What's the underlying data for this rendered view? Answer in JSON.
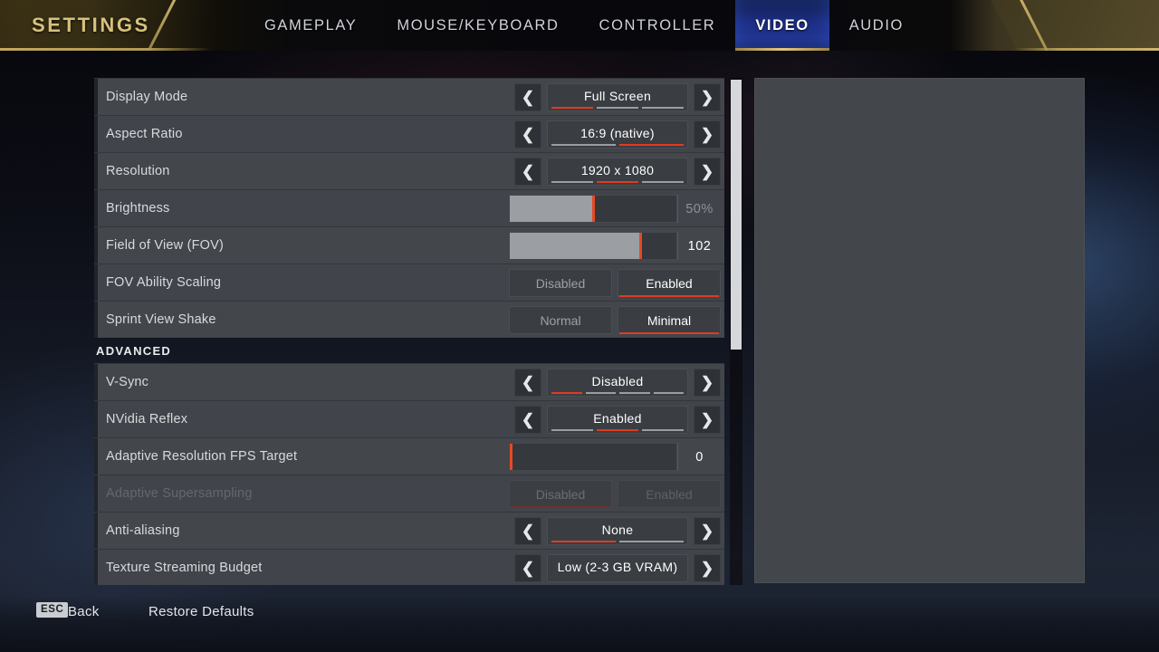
{
  "header": {
    "title": "SETTINGS",
    "tabs": [
      {
        "label": "GAMEPLAY",
        "active": false
      },
      {
        "label": "MOUSE/KEYBOARD",
        "active": false
      },
      {
        "label": "CONTROLLER",
        "active": false
      },
      {
        "label": "VIDEO",
        "active": true
      },
      {
        "label": "AUDIO",
        "active": false
      }
    ]
  },
  "accent_colors": {
    "gold": "#c2a85f",
    "active_tab_blue": "#20348f",
    "selection_red": "#e03b20",
    "row_background": "#43464b",
    "slider_fill": "#9b9ea2"
  },
  "settings": [
    {
      "name": "display-mode",
      "label": "Display Mode",
      "type": "spinner",
      "value": "Full Screen",
      "segments": 3,
      "selected_index": 0
    },
    {
      "name": "aspect-ratio",
      "label": "Aspect Ratio",
      "type": "spinner",
      "value": "16:9 (native)",
      "segments": 2,
      "selected_index": 1
    },
    {
      "name": "resolution",
      "label": "Resolution",
      "type": "spinner",
      "value": "1920 x 1080",
      "segments": 3,
      "selected_index": 1
    },
    {
      "name": "brightness",
      "label": "Brightness",
      "type": "slider",
      "value": "50%",
      "fill_percent": 50,
      "dim_value": true
    },
    {
      "name": "field-of-view",
      "label": "Field of View (FOV)",
      "type": "slider",
      "value": "102",
      "fill_percent": 78,
      "dim_value": false
    },
    {
      "name": "fov-ability-scaling",
      "label": "FOV Ability Scaling",
      "type": "toggle",
      "options": [
        "Disabled",
        "Enabled"
      ],
      "selected_index": 1,
      "disabled": false
    },
    {
      "name": "sprint-view-shake",
      "label": "Sprint View Shake",
      "type": "toggle",
      "options": [
        "Normal",
        "Minimal"
      ],
      "selected_index": 1,
      "disabled": false
    },
    {
      "name": "advanced-section",
      "label": "ADVANCED",
      "type": "section"
    },
    {
      "name": "v-sync",
      "label": "V-Sync",
      "type": "spinner",
      "value": "Disabled",
      "segments": 4,
      "selected_index": 0
    },
    {
      "name": "nvidia-reflex",
      "label": "NVidia Reflex",
      "type": "spinner",
      "value": "Enabled",
      "segments": 3,
      "selected_index": 1
    },
    {
      "name": "adaptive-resolution-fps-target",
      "label": "Adaptive Resolution FPS Target",
      "type": "slider",
      "value": "0",
      "fill_percent": 0,
      "dim_value": false
    },
    {
      "name": "adaptive-supersampling",
      "label": "Adaptive Supersampling",
      "type": "toggle",
      "options": [
        "Disabled",
        "Enabled"
      ],
      "selected_index": 0,
      "disabled": true
    },
    {
      "name": "anti-aliasing",
      "label": "Anti-aliasing",
      "type": "spinner",
      "value": "None",
      "segments": 2,
      "selected_index": 0
    },
    {
      "name": "texture-streaming-budget",
      "label": "Texture Streaming Budget",
      "type": "spinner",
      "value": "Low (2-3 GB VRAM)",
      "segments": 0,
      "selected_index": -1
    }
  ],
  "icons": {
    "arrow_left": "❮",
    "arrow_right": "❯"
  },
  "footer": {
    "esc_key": "ESC",
    "back_label": "Back",
    "restore_label": "Restore Defaults"
  }
}
